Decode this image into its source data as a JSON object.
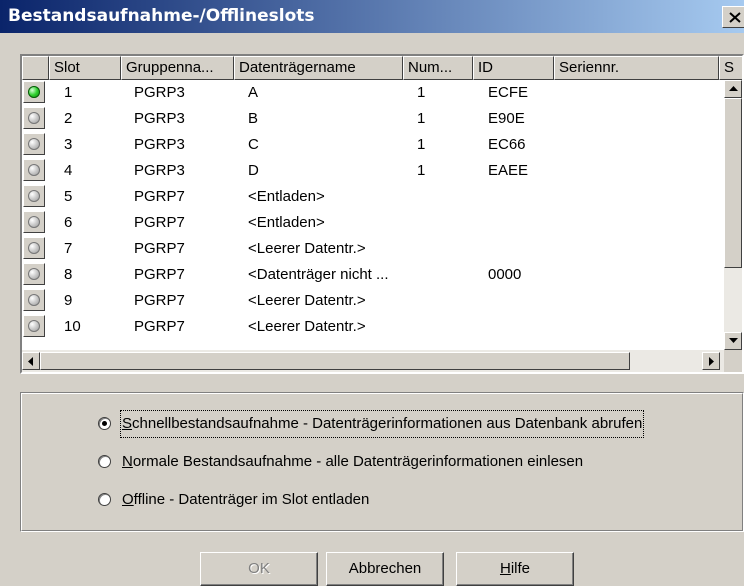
{
  "window": {
    "title": "Bestandsaufnahme-/Offlineslots"
  },
  "columns": [
    "Slot",
    "Gruppenna...",
    "Datenträgername",
    "Num...",
    "ID",
    "Seriennr.",
    "S"
  ],
  "rows": [
    {
      "slot": "1",
      "group": "PGRP3",
      "name": "A",
      "num": "1",
      "id": "ECFE",
      "serial": "",
      "led": "green"
    },
    {
      "slot": "2",
      "group": "PGRP3",
      "name": "B",
      "num": "1",
      "id": "E90E",
      "serial": "",
      "led": "gray"
    },
    {
      "slot": "3",
      "group": "PGRP3",
      "name": "C",
      "num": "1",
      "id": "EC66",
      "serial": "",
      "led": "gray"
    },
    {
      "slot": "4",
      "group": "PGRP3",
      "name": "D",
      "num": "1",
      "id": "EAEE",
      "serial": "",
      "led": "gray"
    },
    {
      "slot": "5",
      "group": "PGRP7",
      "name": "<Entladen>",
      "num": "",
      "id": "",
      "serial": "",
      "led": "gray"
    },
    {
      "slot": "6",
      "group": "PGRP7",
      "name": "<Entladen>",
      "num": "",
      "id": "",
      "serial": "",
      "led": "gray"
    },
    {
      "slot": "7",
      "group": "PGRP7",
      "name": "<Leerer Datentr.>",
      "num": "",
      "id": "",
      "serial": "",
      "led": "gray"
    },
    {
      "slot": "8",
      "group": "PGRP7",
      "name": "<Datenträger nicht ...",
      "num": "",
      "id": "0000",
      "serial": "",
      "led": "gray"
    },
    {
      "slot": "9",
      "group": "PGRP7",
      "name": "<Leerer Datentr.>",
      "num": "",
      "id": "",
      "serial": "",
      "led": "gray"
    },
    {
      "slot": "10",
      "group": "PGRP7",
      "name": "<Leerer Datentr.>",
      "num": "",
      "id": "",
      "serial": "",
      "led": "gray"
    }
  ],
  "options": [
    {
      "key": "S",
      "rest": "chnellbestandsaufnahme - Datenträgerinformationen aus Datenbank abrufen",
      "checked": true
    },
    {
      "key": "N",
      "rest": "ormale Bestandsaufnahme - alle Datenträgerinformationen einlesen",
      "checked": false
    },
    {
      "key": "O",
      "rest": "ffline - Datenträger im Slot entladen",
      "checked": false
    }
  ],
  "buttons": {
    "ok": "OK",
    "cancel": "Abbrechen",
    "help_key": "H",
    "help_rest": "ilfe"
  },
  "colors": {
    "title_start": "#0a246a",
    "title_end": "#a6caf0",
    "face": "#d4d0c8",
    "led_on": "#2fd02f"
  }
}
